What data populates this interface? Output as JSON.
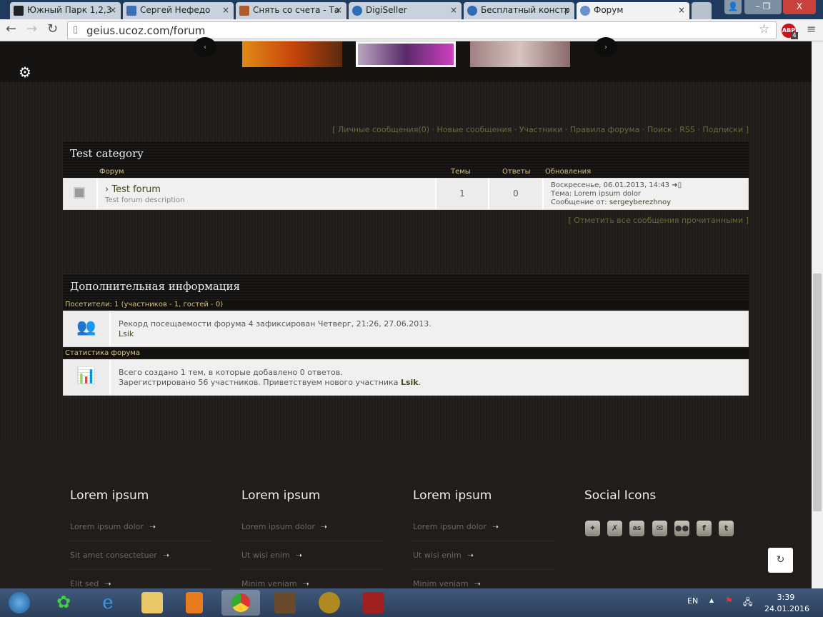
{
  "browser": {
    "tabs": [
      {
        "label": "Южный Парк 1,2,3"
      },
      {
        "label": "Сергей Нефедо"
      },
      {
        "label": "Снять со счета - Та"
      },
      {
        "label": "DigiSeller"
      },
      {
        "label": "Бесплатный констр"
      },
      {
        "label": "Форум"
      }
    ],
    "url": "geius.ucoz.com/forum",
    "abp_badge": "4",
    "abp_label": "ABP"
  },
  "forum": {
    "top_links": [
      "Личные сообщения(0)",
      "Новые сообщения",
      "Участники",
      "Правила форума",
      "Поиск",
      "RSS",
      "Подписки"
    ],
    "category": "Test category",
    "headers": {
      "forum": "Форум",
      "topics": "Темы",
      "replies": "Ответы",
      "updates": "Обновления"
    },
    "row": {
      "title": "Test forum",
      "description": "Test forum description",
      "topics": "1",
      "replies": "0",
      "last_date": "Воскресенье, 06.01.2013, 14:43",
      "topic_label": "Тема:",
      "topic": "Lorem ipsum dolor",
      "author_label": "Сообщение от:",
      "author": "sergeyberezhnoy"
    },
    "mark_read": "Отметить все сообщения прочитанными",
    "info_title": "Дополнительная информация",
    "visitors": "Посетители: 1  (участников - 1, гостей - 0)",
    "record": "Рекорд посещаемости форума 4 зафиксирован Четверг, 21:26, 27.06.2013.",
    "online_user": "Lsik",
    "stats_title": "Статистика форума",
    "stats_line1": "Всего создано 1 тем, в которые добавлено 0 ответов.",
    "stats_line2": "Зарегистрировано 56 участников. Приветствуем нового участника",
    "new_user": "Lsik"
  },
  "footer": {
    "columns": [
      {
        "title": "Lorem ipsum",
        "links": [
          "Lorem ipsum dolor",
          "Sit amet consectetuer",
          "Elit sed"
        ]
      },
      {
        "title": "Lorem ipsum",
        "links": [
          "Lorem ipsum dolor",
          "Ut wisi enim",
          "Minim veniam"
        ]
      },
      {
        "title": "Lorem ipsum",
        "links": [
          "Lorem ipsum dolor",
          "Ut wisi enim",
          "Minim veniam"
        ]
      }
    ],
    "social_title": "Social Icons",
    "social": [
      "myspace",
      "xing",
      "lastfm",
      "email",
      "flickr",
      "facebook",
      "twitter"
    ]
  },
  "taskbar": {
    "lang": "EN",
    "time": "3:39",
    "date": "24.01.2016"
  }
}
